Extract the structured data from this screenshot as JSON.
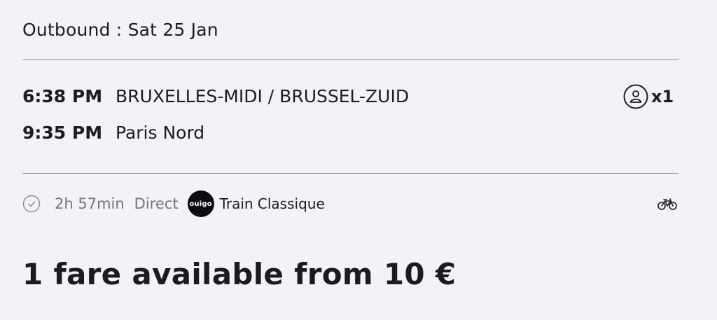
{
  "header": {
    "title": "Outbound : Sat 25 Jan"
  },
  "journey": {
    "departure": {
      "time": "6:38 PM",
      "station": "BRUXELLES-MIDI / BRUSSEL-ZUID"
    },
    "arrival": {
      "time": "9:35 PM",
      "station": "Paris Nord"
    },
    "passengers": {
      "icon": "user-circle-icon",
      "count": "x1"
    }
  },
  "details": {
    "duration_icon": "clock-icon",
    "duration": "2h 57min",
    "connection": "Direct",
    "brand_logo_text": "OUIGO",
    "train_type": "Train Classique",
    "bike_icon": "bicycle-icon"
  },
  "fare": {
    "summary": "1 fare available from 10 €"
  },
  "colors": {
    "background": "#f3f2f7",
    "text": "#1b1b24",
    "muted": "#75757f",
    "divider": "#8a8a96",
    "logo_bg": "#0b0b12"
  }
}
